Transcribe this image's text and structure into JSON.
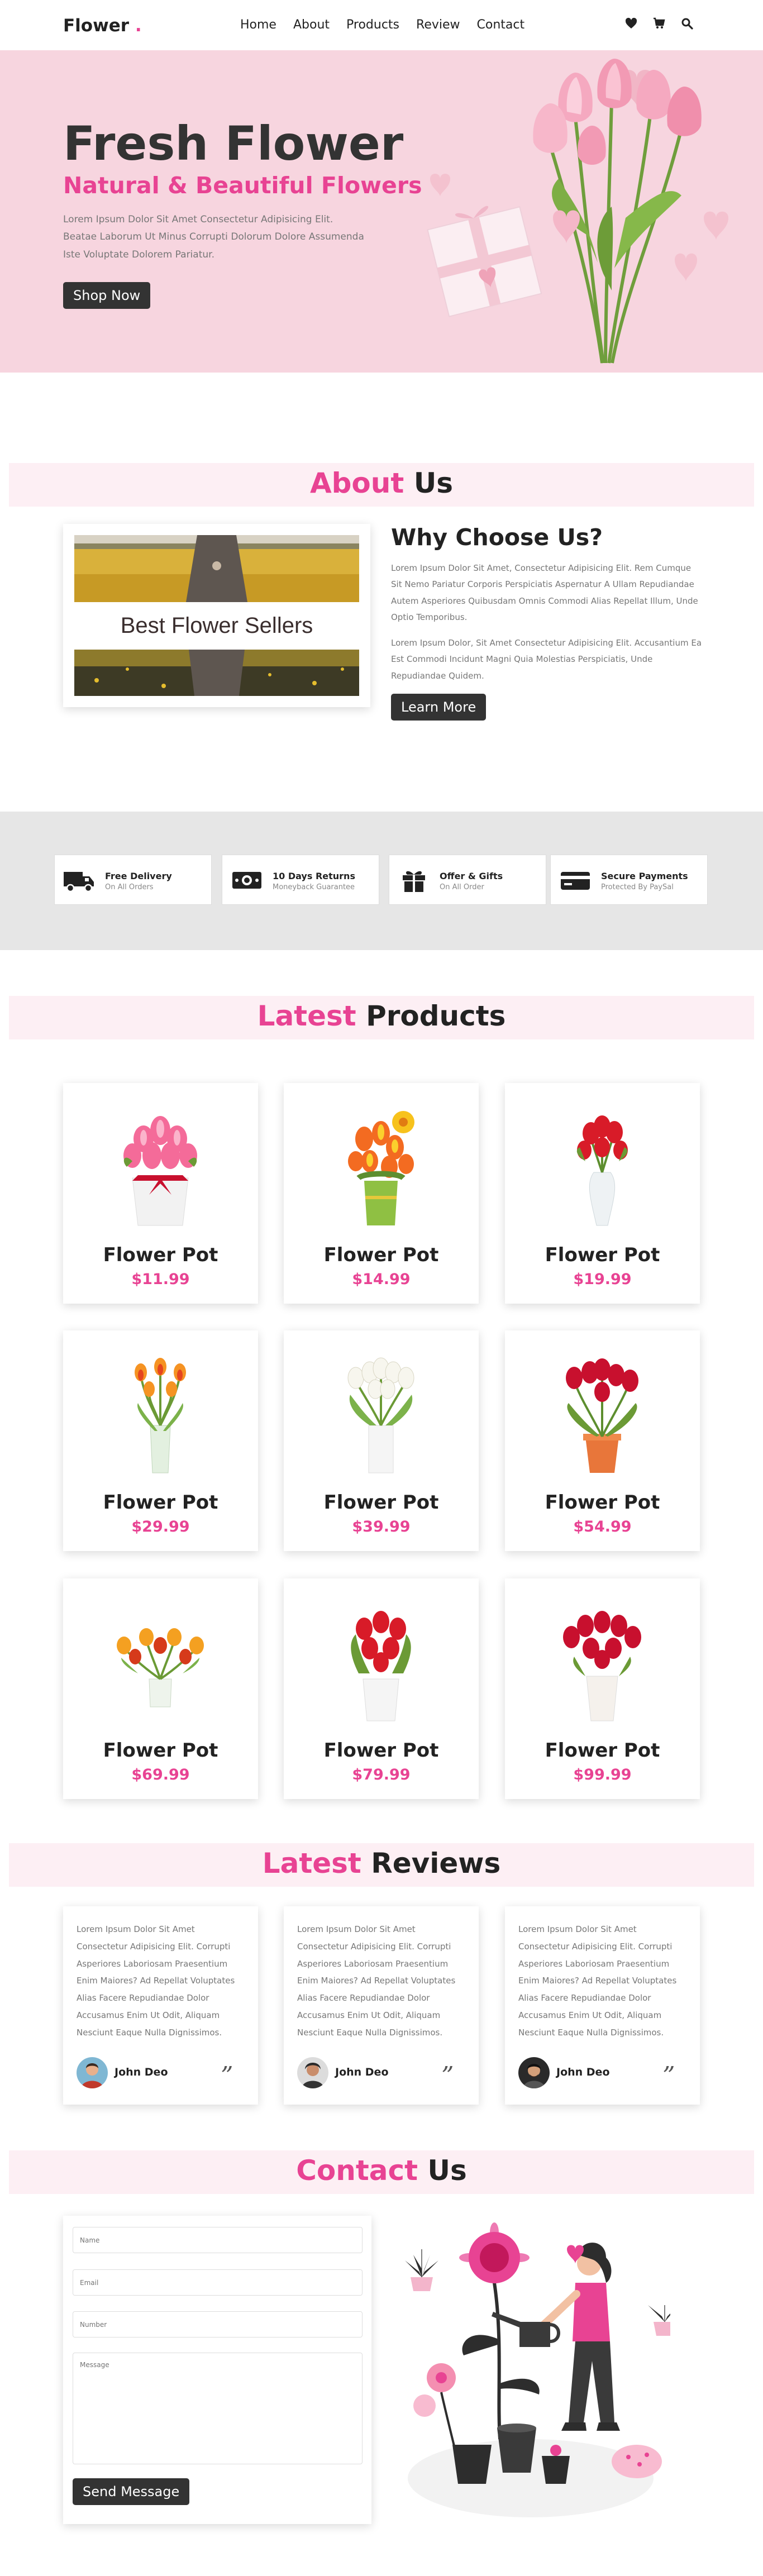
{
  "header": {
    "logo": "Flower",
    "logo_dot": ".",
    "nav": [
      "Home",
      "About",
      "Products",
      "Review",
      "Contact"
    ]
  },
  "hero": {
    "title": "Fresh Flower",
    "subtitle": "Natural & Beautiful Flowers",
    "text": "Lorem Ipsum Dolor Sit Amet Consectetur Adipisicing Elit. Beatae Laborum Ut Minus Corrupti Dolorum Dolore Assumenda Iste Voluptate Dolorem Pariatur.",
    "button": "Shop Now"
  },
  "about": {
    "title_accent": "About",
    "title_rest": " Us",
    "image_caption": "Best Flower Sellers",
    "heading": "Why Choose Us?",
    "p1": "Lorem Ipsum Dolor Sit Amet, Consectetur Adipisicing Elit. Rem Cumque Sit Nemo Pariatur Corporis Perspiciatis Aspernatur A Ullam Repudiandae Autem Asperiores Quibusdam Omnis Commodi Alias Repellat Illum, Unde Optio Temporibus.",
    "p2": "Lorem Ipsum Dolor, Sit Amet Consectetur Adipisicing Elit. Accusantium Ea Est Commodi Incidunt Magni Quia Molestias Perspiciatis, Unde Repudiandae Quidem.",
    "button": "Learn More"
  },
  "features": [
    {
      "title": "Free Delivery",
      "sub": "On All Orders",
      "icon": "truck-icon"
    },
    {
      "title": "10 Days Returns",
      "sub": "Moneyback Guarantee",
      "icon": "money-icon"
    },
    {
      "title": "Offer & Gifts",
      "sub": "On All Order",
      "icon": "gift-icon"
    },
    {
      "title": "Secure Payments",
      "sub": "Protected By PaySal",
      "icon": "credit-card-icon"
    }
  ],
  "products": {
    "title_accent": "Latest",
    "title_rest": " Products",
    "items": [
      {
        "name": "Flower Pot",
        "price": "$11.99"
      },
      {
        "name": "Flower Pot",
        "price": "$14.99"
      },
      {
        "name": "Flower Pot",
        "price": "$19.99"
      },
      {
        "name": "Flower Pot",
        "price": "$29.99"
      },
      {
        "name": "Flower Pot",
        "price": "$39.99"
      },
      {
        "name": "Flower Pot",
        "price": "$54.99"
      },
      {
        "name": "Flower Pot",
        "price": "$69.99"
      },
      {
        "name": "Flower Pot",
        "price": "$79.99"
      },
      {
        "name": "Flower Pot",
        "price": "$99.99"
      }
    ]
  },
  "reviews": {
    "title_accent": "Latest",
    "title_rest": " Reviews",
    "items": [
      {
        "text": "Lorem Ipsum Dolor Sit Amet Consectetur Adipisicing Elit. Corrupti Asperiores Laboriosam Praesentium Enim Maiores? Ad Repellat Voluptates Alias Facere Repudiandae Dolor Accusamus Enim Ut Odit, Aliquam Nesciunt Eaque Nulla Dignissimos.",
        "name": "John Deo",
        "quote": "”"
      },
      {
        "text": "Lorem Ipsum Dolor Sit Amet Consectetur Adipisicing Elit. Corrupti Asperiores Laboriosam Praesentium Enim Maiores? Ad Repellat Voluptates Alias Facere Repudiandae Dolor Accusamus Enim Ut Odit, Aliquam Nesciunt Eaque Nulla Dignissimos.",
        "name": "John Deo",
        "quote": "”"
      },
      {
        "text": "Lorem Ipsum Dolor Sit Amet Consectetur Adipisicing Elit. Corrupti Asperiores Laboriosam Praesentium Enim Maiores? Ad Repellat Voluptates Alias Facere Repudiandae Dolor Accusamus Enim Ut Odit, Aliquam Nesciunt Eaque Nulla Dignissimos.",
        "name": "John Deo",
        "quote": "”"
      }
    ]
  },
  "contact": {
    "title_accent": "Contact",
    "title_rest": " Us",
    "name_placeholder": "Name",
    "email_placeholder": "Email",
    "number_placeholder": "Number",
    "message_placeholder": "Message",
    "button": "Send Message"
  },
  "colors": {
    "accent": "#e84393",
    "hero_bg": "#f7d5df",
    "section_bar": "#fdeff4",
    "features_bg": "#e6e6e6",
    "dark_button": "#333333"
  }
}
